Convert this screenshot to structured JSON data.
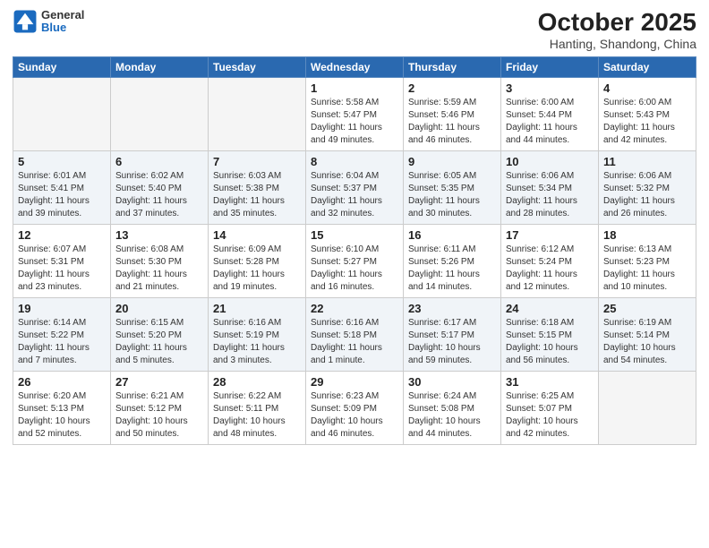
{
  "logo": {
    "general": "General",
    "blue": "Blue"
  },
  "title": "October 2025",
  "subtitle": "Hanting, Shandong, China",
  "days_of_week": [
    "Sunday",
    "Monday",
    "Tuesday",
    "Wednesday",
    "Thursday",
    "Friday",
    "Saturday"
  ],
  "weeks": [
    [
      {
        "day": "",
        "empty": true
      },
      {
        "day": "",
        "empty": true
      },
      {
        "day": "",
        "empty": true
      },
      {
        "day": "1",
        "sunrise": "Sunrise: 5:58 AM",
        "sunset": "Sunset: 5:47 PM",
        "daylight": "Daylight: 11 hours and 49 minutes."
      },
      {
        "day": "2",
        "sunrise": "Sunrise: 5:59 AM",
        "sunset": "Sunset: 5:46 PM",
        "daylight": "Daylight: 11 hours and 46 minutes."
      },
      {
        "day": "3",
        "sunrise": "Sunrise: 6:00 AM",
        "sunset": "Sunset: 5:44 PM",
        "daylight": "Daylight: 11 hours and 44 minutes."
      },
      {
        "day": "4",
        "sunrise": "Sunrise: 6:00 AM",
        "sunset": "Sunset: 5:43 PM",
        "daylight": "Daylight: 11 hours and 42 minutes."
      }
    ],
    [
      {
        "day": "5",
        "sunrise": "Sunrise: 6:01 AM",
        "sunset": "Sunset: 5:41 PM",
        "daylight": "Daylight: 11 hours and 39 minutes."
      },
      {
        "day": "6",
        "sunrise": "Sunrise: 6:02 AM",
        "sunset": "Sunset: 5:40 PM",
        "daylight": "Daylight: 11 hours and 37 minutes."
      },
      {
        "day": "7",
        "sunrise": "Sunrise: 6:03 AM",
        "sunset": "Sunset: 5:38 PM",
        "daylight": "Daylight: 11 hours and 35 minutes."
      },
      {
        "day": "8",
        "sunrise": "Sunrise: 6:04 AM",
        "sunset": "Sunset: 5:37 PM",
        "daylight": "Daylight: 11 hours and 32 minutes."
      },
      {
        "day": "9",
        "sunrise": "Sunrise: 6:05 AM",
        "sunset": "Sunset: 5:35 PM",
        "daylight": "Daylight: 11 hours and 30 minutes."
      },
      {
        "day": "10",
        "sunrise": "Sunrise: 6:06 AM",
        "sunset": "Sunset: 5:34 PM",
        "daylight": "Daylight: 11 hours and 28 minutes."
      },
      {
        "day": "11",
        "sunrise": "Sunrise: 6:06 AM",
        "sunset": "Sunset: 5:32 PM",
        "daylight": "Daylight: 11 hours and 26 minutes."
      }
    ],
    [
      {
        "day": "12",
        "sunrise": "Sunrise: 6:07 AM",
        "sunset": "Sunset: 5:31 PM",
        "daylight": "Daylight: 11 hours and 23 minutes."
      },
      {
        "day": "13",
        "sunrise": "Sunrise: 6:08 AM",
        "sunset": "Sunset: 5:30 PM",
        "daylight": "Daylight: 11 hours and 21 minutes."
      },
      {
        "day": "14",
        "sunrise": "Sunrise: 6:09 AM",
        "sunset": "Sunset: 5:28 PM",
        "daylight": "Daylight: 11 hours and 19 minutes."
      },
      {
        "day": "15",
        "sunrise": "Sunrise: 6:10 AM",
        "sunset": "Sunset: 5:27 PM",
        "daylight": "Daylight: 11 hours and 16 minutes."
      },
      {
        "day": "16",
        "sunrise": "Sunrise: 6:11 AM",
        "sunset": "Sunset: 5:26 PM",
        "daylight": "Daylight: 11 hours and 14 minutes."
      },
      {
        "day": "17",
        "sunrise": "Sunrise: 6:12 AM",
        "sunset": "Sunset: 5:24 PM",
        "daylight": "Daylight: 11 hours and 12 minutes."
      },
      {
        "day": "18",
        "sunrise": "Sunrise: 6:13 AM",
        "sunset": "Sunset: 5:23 PM",
        "daylight": "Daylight: 11 hours and 10 minutes."
      }
    ],
    [
      {
        "day": "19",
        "sunrise": "Sunrise: 6:14 AM",
        "sunset": "Sunset: 5:22 PM",
        "daylight": "Daylight: 11 hours and 7 minutes."
      },
      {
        "day": "20",
        "sunrise": "Sunrise: 6:15 AM",
        "sunset": "Sunset: 5:20 PM",
        "daylight": "Daylight: 11 hours and 5 minutes."
      },
      {
        "day": "21",
        "sunrise": "Sunrise: 6:16 AM",
        "sunset": "Sunset: 5:19 PM",
        "daylight": "Daylight: 11 hours and 3 minutes."
      },
      {
        "day": "22",
        "sunrise": "Sunrise: 6:16 AM",
        "sunset": "Sunset: 5:18 PM",
        "daylight": "Daylight: 11 hours and 1 minute."
      },
      {
        "day": "23",
        "sunrise": "Sunrise: 6:17 AM",
        "sunset": "Sunset: 5:17 PM",
        "daylight": "Daylight: 10 hours and 59 minutes."
      },
      {
        "day": "24",
        "sunrise": "Sunrise: 6:18 AM",
        "sunset": "Sunset: 5:15 PM",
        "daylight": "Daylight: 10 hours and 56 minutes."
      },
      {
        "day": "25",
        "sunrise": "Sunrise: 6:19 AM",
        "sunset": "Sunset: 5:14 PM",
        "daylight": "Daylight: 10 hours and 54 minutes."
      }
    ],
    [
      {
        "day": "26",
        "sunrise": "Sunrise: 6:20 AM",
        "sunset": "Sunset: 5:13 PM",
        "daylight": "Daylight: 10 hours and 52 minutes."
      },
      {
        "day": "27",
        "sunrise": "Sunrise: 6:21 AM",
        "sunset": "Sunset: 5:12 PM",
        "daylight": "Daylight: 10 hours and 50 minutes."
      },
      {
        "day": "28",
        "sunrise": "Sunrise: 6:22 AM",
        "sunset": "Sunset: 5:11 PM",
        "daylight": "Daylight: 10 hours and 48 minutes."
      },
      {
        "day": "29",
        "sunrise": "Sunrise: 6:23 AM",
        "sunset": "Sunset: 5:09 PM",
        "daylight": "Daylight: 10 hours and 46 minutes."
      },
      {
        "day": "30",
        "sunrise": "Sunrise: 6:24 AM",
        "sunset": "Sunset: 5:08 PM",
        "daylight": "Daylight: 10 hours and 44 minutes."
      },
      {
        "day": "31",
        "sunrise": "Sunrise: 6:25 AM",
        "sunset": "Sunset: 5:07 PM",
        "daylight": "Daylight: 10 hours and 42 minutes."
      },
      {
        "day": "",
        "empty": true
      }
    ]
  ]
}
